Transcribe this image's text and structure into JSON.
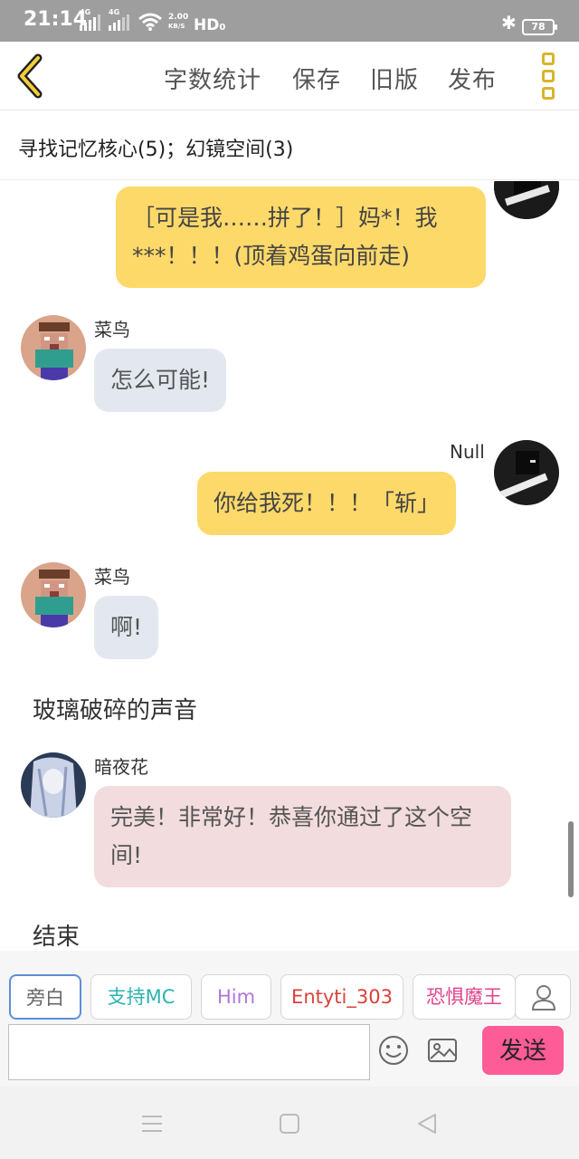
{
  "status_bar": {
    "time": "21:14",
    "network1": "4G",
    "network2": "4G",
    "speed_value": "2.00",
    "speed_unit": "KB/S",
    "hd": "HD",
    "hd_sub": "0",
    "battery": "78"
  },
  "toolbar": {
    "word_count": "字数统计",
    "save": "保存",
    "old_version": "旧版",
    "publish": "发布",
    "accent_color": "#d8b52a"
  },
  "document": {
    "title": "寻找记忆核心(5)；幻镜空间(3)"
  },
  "chat": {
    "messages": [
      {
        "speaker": "",
        "text": "［可是我……拼了！］妈*！我***！！！(顶着鸡蛋向前走)"
      },
      {
        "speaker": "菜鸟",
        "text": "怎么可能!"
      },
      {
        "speaker": "Null",
        "text": "你给我死！！！「斩」"
      },
      {
        "speaker": "菜鸟",
        "text": "啊!"
      },
      {
        "narration": "玻璃破碎的声音"
      },
      {
        "speaker": "暗夜花",
        "text": "完美！非常好！恭喜你通过了这个空间!"
      },
      {
        "narration": "结束"
      }
    ]
  },
  "roles": [
    {
      "label": "旁白",
      "color": "#666666"
    },
    {
      "label": "支持MC",
      "color": "#2bb3b0"
    },
    {
      "label": "Him",
      "color": "#b275d6"
    },
    {
      "label": "Entyti_303",
      "color": "#d9423a"
    },
    {
      "label": "恐惧魔王",
      "color": "#e0458c"
    }
  ],
  "composer": {
    "placeholder": "",
    "send": "发送",
    "send_color": "#fd5c96"
  }
}
